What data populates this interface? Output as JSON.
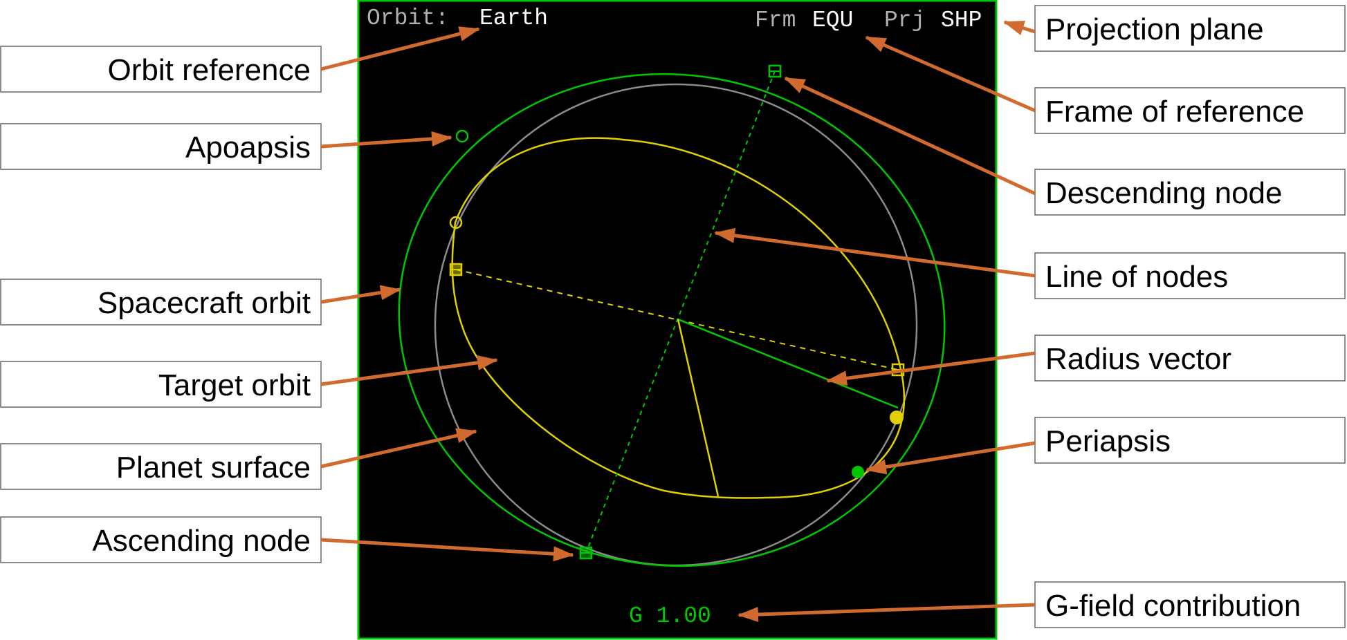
{
  "mfd": {
    "orbit_label": "Orbit:",
    "orbit_reference": "Earth",
    "frame_label": "Frm",
    "frame_value": "EQU",
    "projection_label": "Prj",
    "projection_value": "SHP",
    "gfield_text": "G 1.00"
  },
  "callouts": {
    "orbit_reference": "Orbit reference",
    "apoapsis": "Apoapsis",
    "spacecraft_orbit": "Spacecraft orbit",
    "target_orbit": "Target orbit",
    "planet_surface": "Planet surface",
    "ascending_node": "Ascending node",
    "projection_plane": "Projection plane",
    "frame_of_reference": "Frame of reference",
    "descending_node": "Descending node",
    "line_of_nodes": "Line of nodes",
    "radius_vector": "Radius vector",
    "periapsis": "Periapsis",
    "gfield_contribution": "G-field contribution"
  },
  "colors": {
    "screen_bg": "#000000",
    "screen_border": "#00c800",
    "spacecraft_orbit": "#00c800",
    "target_orbit": "#e0d000",
    "planet_surface": "#8c8c8c",
    "label_dim": "#b0b0b0",
    "label_bright": "#ffffff",
    "arrow": "#d06a2f",
    "box_border": "#666666"
  }
}
